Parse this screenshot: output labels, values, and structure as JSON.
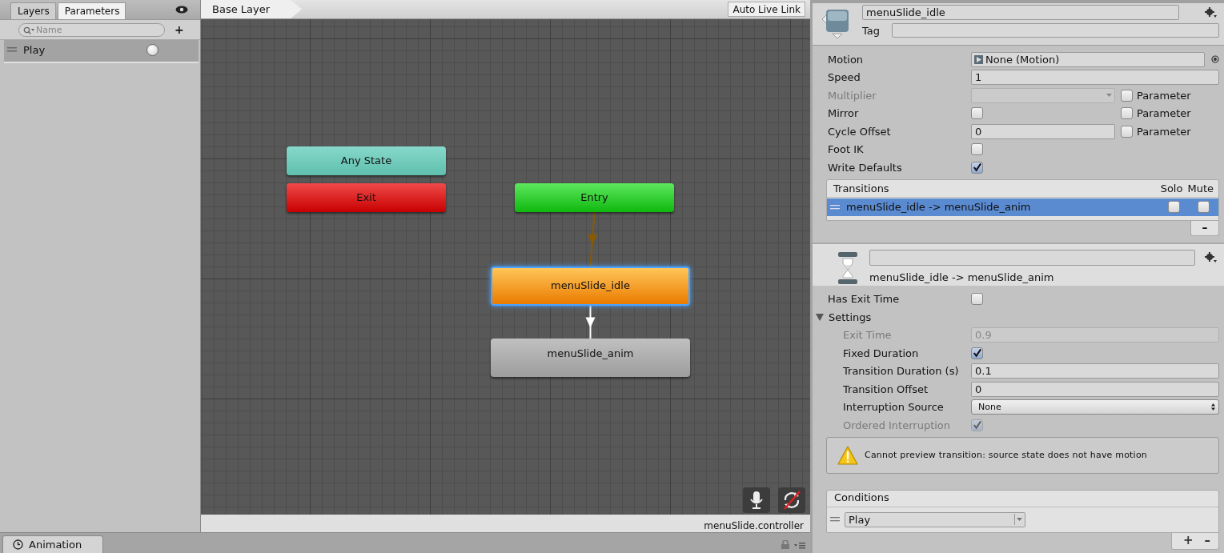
{
  "left_panel": {
    "tabs": [
      {
        "label": "Layers",
        "selected": false
      },
      {
        "label": "Parameters",
        "selected": true
      }
    ],
    "search": {
      "placeholder": "Name"
    },
    "add_button": "+",
    "parameters": [
      {
        "name": "Play",
        "kind": "trigger",
        "on": false
      }
    ]
  },
  "graph": {
    "breadcrumb": "Base Layer",
    "live_link_button": "Auto Live Link",
    "nodes": [
      {
        "label": "Any State",
        "kind": "any",
        "selected": false
      },
      {
        "label": "Exit",
        "kind": "exit",
        "selected": false
      },
      {
        "label": "Entry",
        "kind": "entry",
        "selected": false,
        "arrow_to_next": {
          "kind": "default"
        }
      },
      {
        "label": "menuSlide_idle",
        "kind": "state",
        "default": true,
        "selected": true,
        "arrow_to_next": {
          "kind": "transition"
        }
      },
      {
        "label": "menuSlide_anim",
        "kind": "state",
        "default": false,
        "selected": false
      }
    ],
    "footer": "menuSlide.controller"
  },
  "bottom_tab": {
    "label": "Animation"
  },
  "inspector": {
    "name": "menuSlide_idle",
    "tag_label": "Tag",
    "properties": [
      {
        "label": "Motion",
        "kind": "object",
        "value": "None (Motion)"
      },
      {
        "label": "Speed",
        "kind": "number",
        "value": "1"
      },
      {
        "label": "Multiplier",
        "kind": "dropdown",
        "disabled": true,
        "parameter": {
          "label": "Parameter",
          "checked": false
        }
      },
      {
        "label": "Mirror",
        "kind": "checkbox",
        "checked": false,
        "parameter": {
          "label": "Parameter",
          "checked": false
        }
      },
      {
        "label": "Cycle Offset",
        "kind": "number",
        "value": "0",
        "parameter": {
          "label": "Parameter",
          "checked": false
        }
      },
      {
        "label": "Foot IK",
        "kind": "checkbox",
        "checked": false
      },
      {
        "label": "Write Defaults",
        "kind": "checkbox",
        "checked": true
      }
    ],
    "transitions": {
      "header": "Transitions",
      "solo_header": "Solo",
      "mute_header": "Mute",
      "remove_button": "–",
      "rows": [
        {
          "label": "menuSlide_idle -> menuSlide_anim",
          "selected": true,
          "solo": false,
          "mute": false
        }
      ]
    },
    "transition": {
      "subtitle": "menuSlide_idle -> menuSlide_anim",
      "properties": [
        {
          "label": "Has Exit Time",
          "kind": "checkbox",
          "checked": false
        },
        {
          "label": "Settings",
          "kind": "foldout",
          "expanded": true,
          "children": [
            {
              "label": "Exit Time",
              "kind": "number",
              "value": "0.9",
              "disabled": true
            },
            {
              "label": "Fixed Duration",
              "kind": "checkbox",
              "checked": true
            },
            {
              "label": "Transition Duration (s)",
              "kind": "number",
              "value": "0.1"
            },
            {
              "label": "Transition Offset",
              "kind": "number",
              "value": "0"
            },
            {
              "label": "Interruption Source",
              "kind": "popup",
              "value": "None"
            },
            {
              "label": "Ordered Interruption",
              "kind": "checkbox",
              "checked": true,
              "disabled": true
            }
          ]
        }
      ],
      "warning": "Cannot preview transition: source state does not have motion"
    },
    "conditions": {
      "header": "Conditions",
      "rows": [
        {
          "parameter": "Play"
        }
      ],
      "add_button": "+",
      "remove_button": "–"
    }
  }
}
